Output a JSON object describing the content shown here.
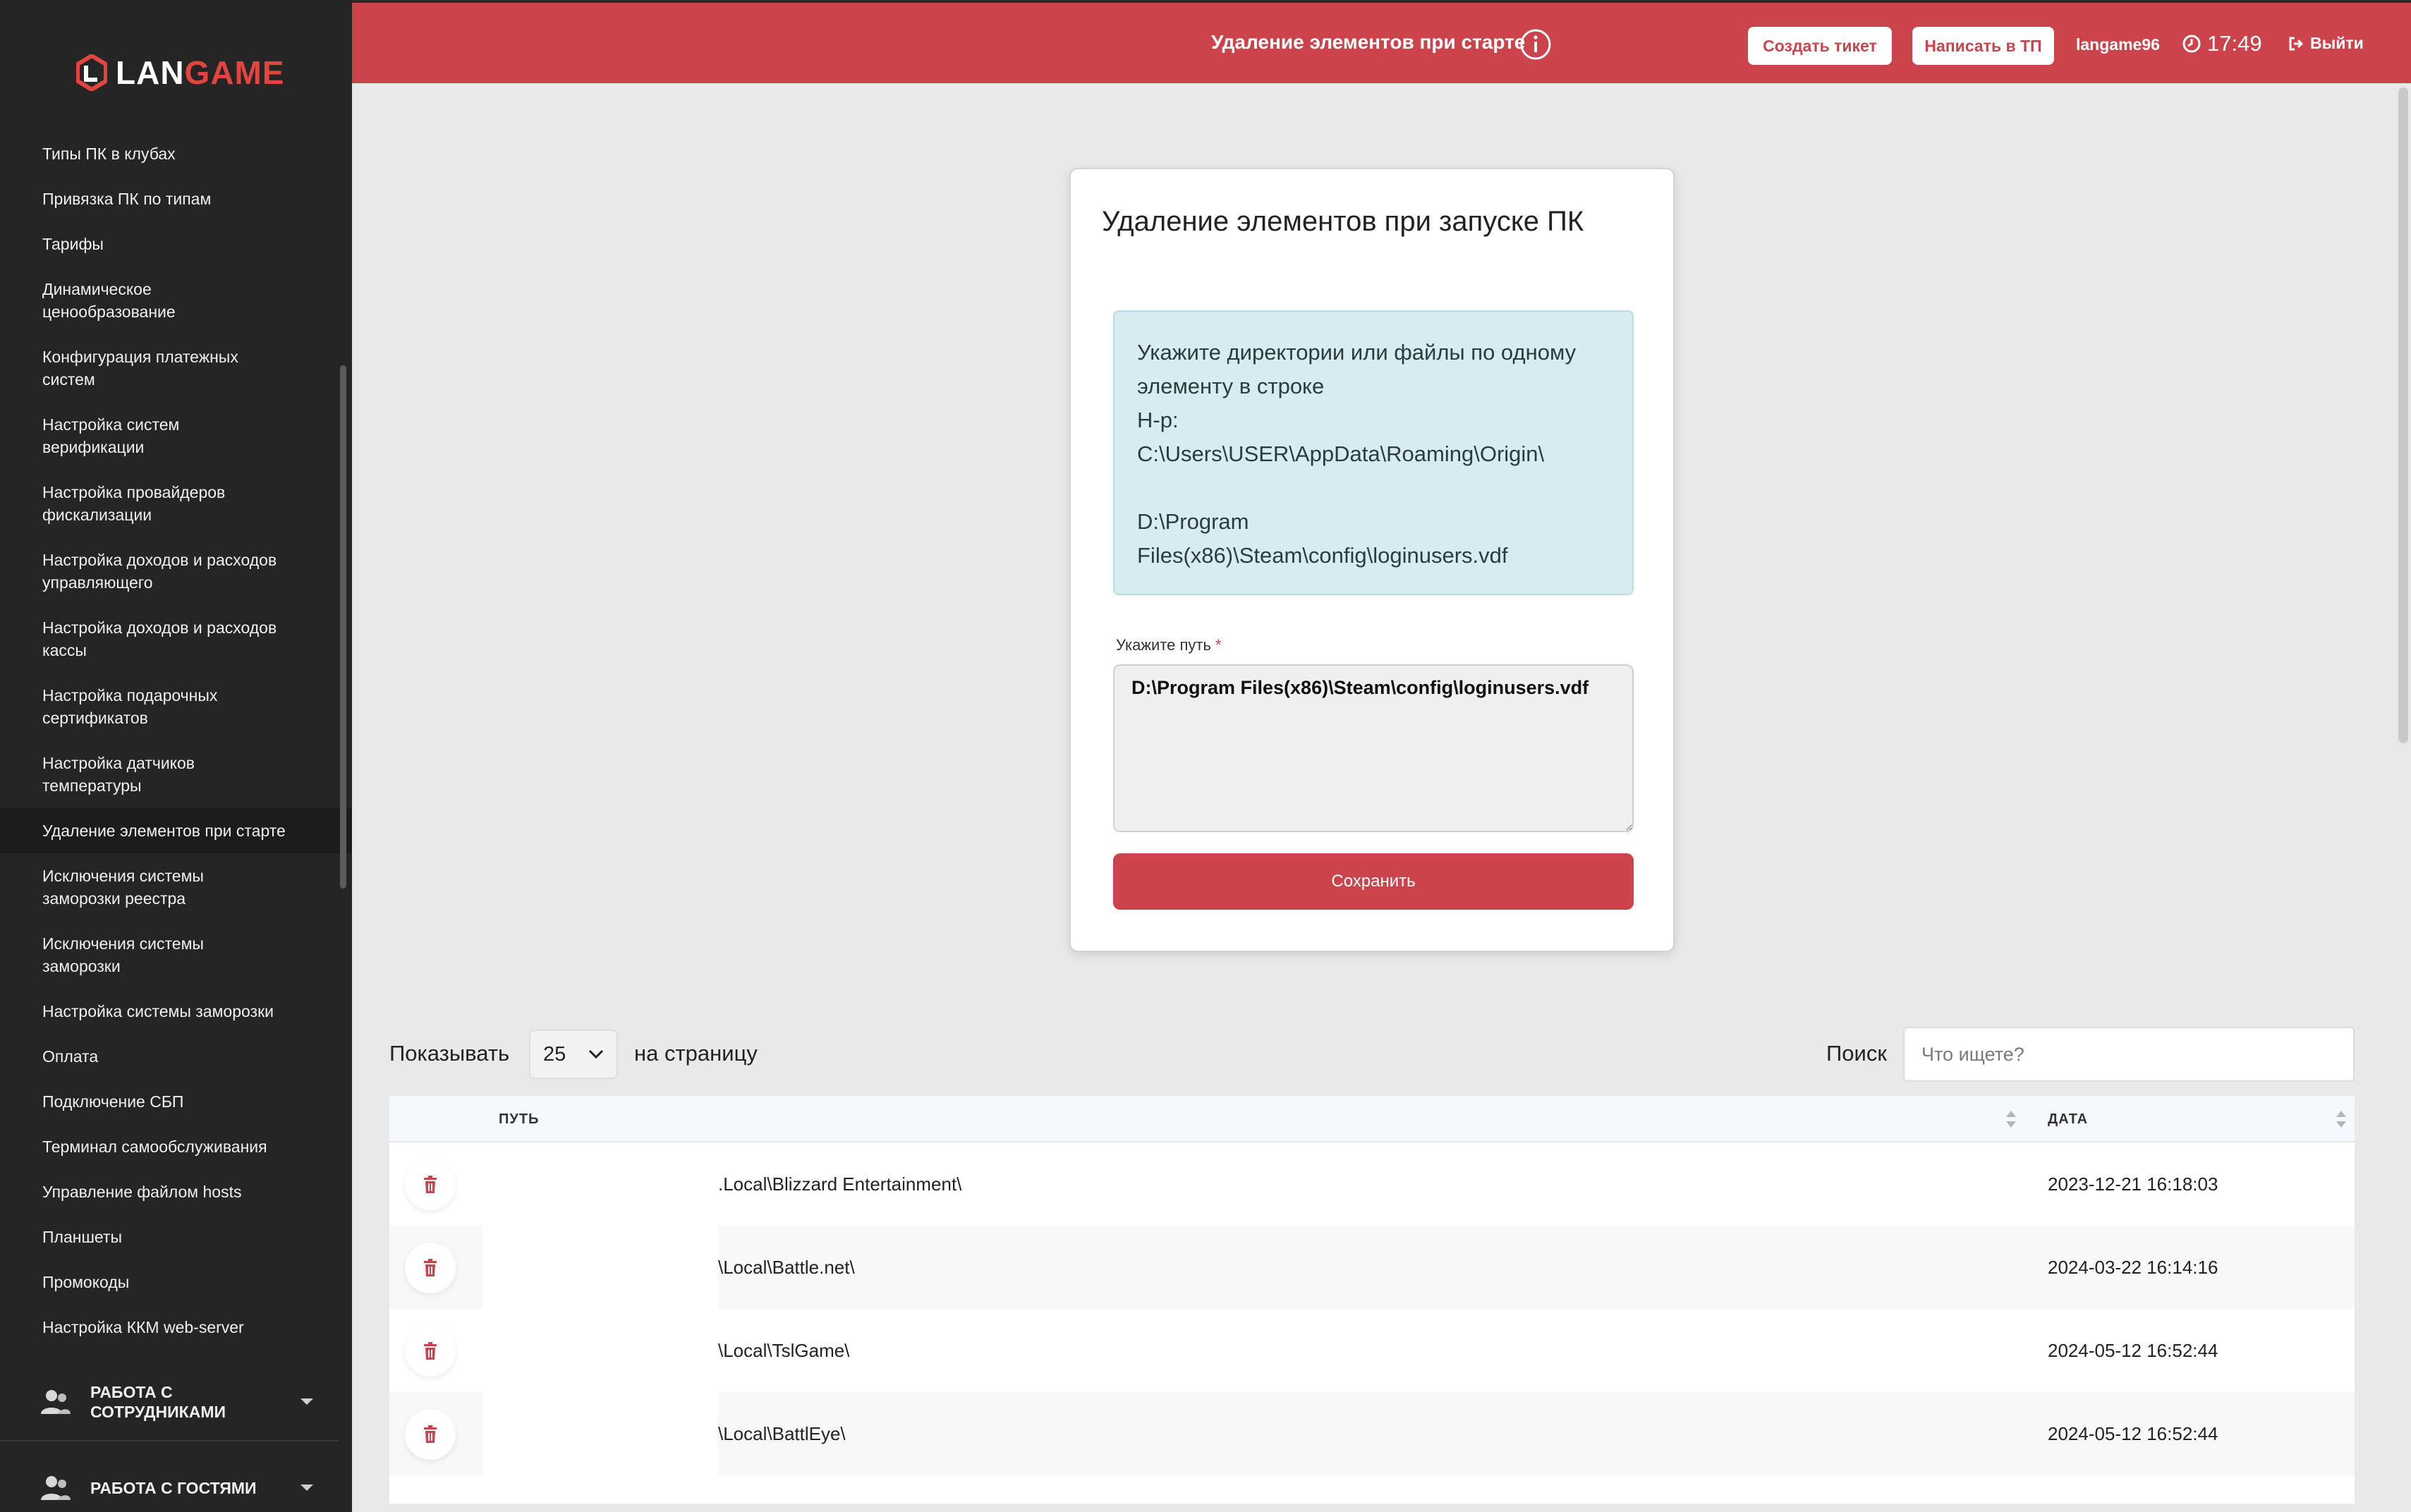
{
  "brand": {
    "logo_text_main": "LAN",
    "logo_text_accent": "GAME",
    "accent_color": "#cc444b"
  },
  "sidebar": {
    "items": [
      {
        "label": "Типы ПК в клубах"
      },
      {
        "label": "Привязка ПК по типам"
      },
      {
        "label": "Тарифы"
      },
      {
        "label": "Динамическое ценообразование"
      },
      {
        "label": "Конфигурация платежных систем"
      },
      {
        "label": "Настройка систем верификации"
      },
      {
        "label": "Настройка провайдеров фискализации"
      },
      {
        "label": "Настройка доходов и расходов управляющего"
      },
      {
        "label": "Настройка доходов и расходов кассы"
      },
      {
        "label": "Настройка подарочных сертификатов"
      },
      {
        "label": "Настройка датчиков температуры"
      },
      {
        "label": "Удаление элементов при старте"
      },
      {
        "label": "Исключения системы заморозки реестра"
      },
      {
        "label": "Исключения системы заморозки"
      },
      {
        "label": "Настройка системы заморозки"
      },
      {
        "label": "Оплата"
      },
      {
        "label": "Подключение СБП"
      },
      {
        "label": "Терминал самообслуживания"
      },
      {
        "label": "Управление файлом hosts"
      },
      {
        "label": "Планшеты"
      },
      {
        "label": "Промокоды"
      },
      {
        "label": "Настройка ККМ web-server"
      }
    ],
    "active_item": "Удаление элементов при старте",
    "groups": [
      {
        "label": "РАБОТА С СОТРУДНИКАМИ",
        "icon": "users-icon"
      },
      {
        "label": "РАБОТА С ГОСТЯМИ",
        "icon": "users-icon"
      }
    ]
  },
  "header": {
    "title": "Удаление элементов при старте",
    "create_ticket": "Создать тикет",
    "write_support": "Написать в ТП",
    "username": "langame96",
    "time": "17:49",
    "logout": "Выйти"
  },
  "card": {
    "title": "Удаление элементов при запуске ПК",
    "alert_lines": [
      "Укажите директории или файлы по одному элементу в строке",
      "Н-р:",
      "C:\\Users\\USER\\AppData\\Roaming\\Origin\\",
      "",
      "D:\\Program Files(x86)\\Steam\\config\\loginusers.vdf"
    ],
    "path_label": "Укажите путь",
    "path_value": "D:\\Program Files(x86)\\Steam\\config\\loginusers.vdf",
    "save_label": "Сохранить"
  },
  "table_controls": {
    "show_label": "Показывать",
    "per_page_value": "25",
    "per_page_label": "на страницу",
    "search_label": "Поиск",
    "search_placeholder": "Что ищете?"
  },
  "table": {
    "headers": {
      "path": "ПУТЬ",
      "date": "ДАТА"
    },
    "rows": [
      {
        "path": ".Local\\Blizzard Entertainment\\",
        "date": "2023-12-21 16:18:03"
      },
      {
        "path": "\\Local\\Battle.net\\",
        "date": "2024-03-22 16:14:16"
      },
      {
        "path": "\\Local\\TslGame\\",
        "date": "2024-05-12 16:52:44"
      },
      {
        "path": "\\Local\\BattlEye\\",
        "date": "2024-05-12 16:52:44"
      }
    ]
  }
}
